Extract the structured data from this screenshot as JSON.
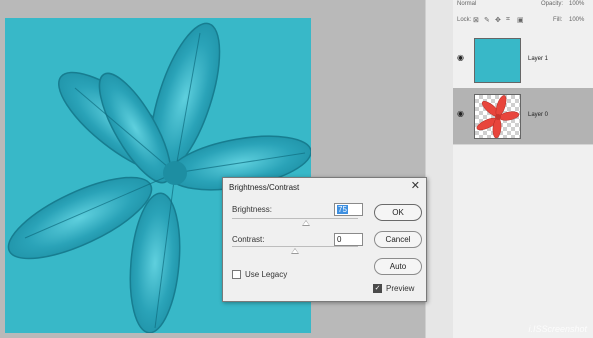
{
  "layers_panel": {
    "blend_mode": "Normal",
    "opacity_label": "Opacity:",
    "opacity_value": "100%",
    "lock_label": "Lock:",
    "fill_label": "Fill:",
    "fill_value": "100%",
    "layers": [
      {
        "name": "Layer 1",
        "thumb": "solid-teal",
        "visible": true,
        "selected": false
      },
      {
        "name": "Layer 0",
        "thumb": "red-flower",
        "visible": true,
        "selected": true
      }
    ]
  },
  "dialog": {
    "title": "Brightness/Contrast",
    "close_glyph": "✕",
    "brightness_label": "Brightness:",
    "brightness_value": "75",
    "contrast_label": "Contrast:",
    "contrast_value": "0",
    "use_legacy_label": "Use Legacy",
    "use_legacy_checked": false,
    "preview_label": "Preview",
    "preview_checked": true,
    "buttons": {
      "ok": "OK",
      "cancel": "Cancel",
      "auto": "Auto"
    }
  },
  "colors": {
    "canvas_bg": "#38b8c8",
    "flower": "#2fa8bd",
    "layer0_flower": "#e8453c",
    "selected_row": "#b3b3b3"
  },
  "icons": [
    "eye-icon",
    "lock-transparency-icon",
    "lock-brush-icon",
    "lock-move-icon",
    "lock-artboard-icon",
    "lock-all-icon",
    "close-icon"
  ],
  "watermark": "i.ISScreenshot"
}
